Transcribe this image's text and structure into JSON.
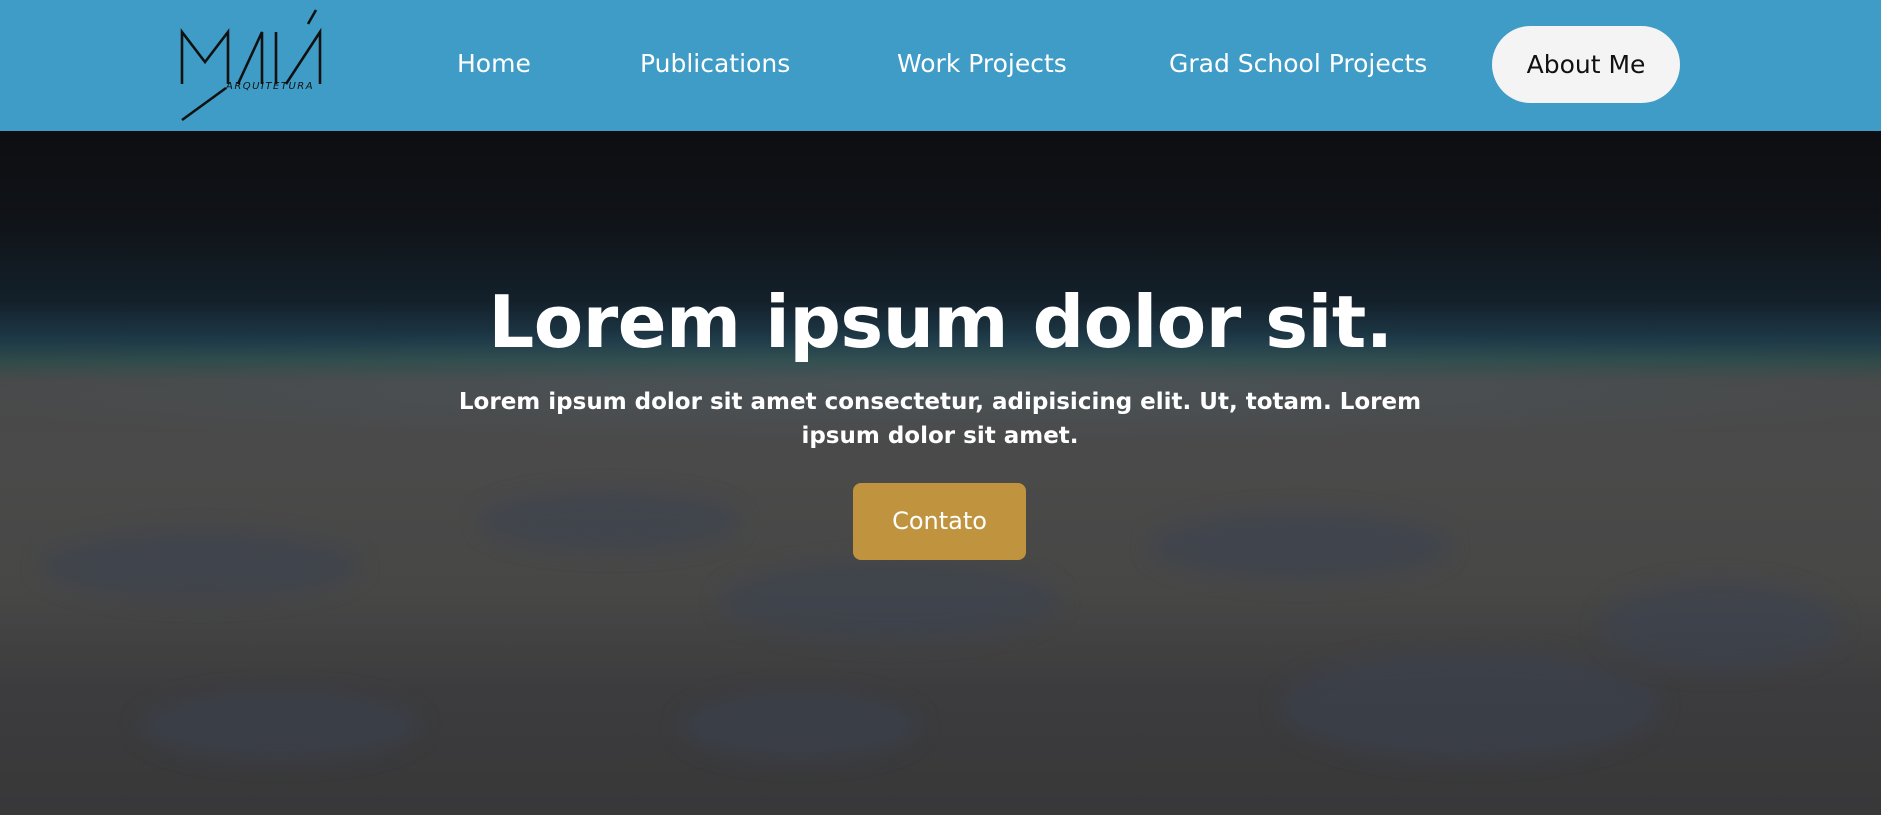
{
  "brand": {
    "logo_text": "MAIÁ",
    "logo_subtitle": "ARQUITETURA"
  },
  "nav": {
    "home": "Home",
    "publications": "Publications",
    "work_projects": "Work Projects",
    "grad_school_projects": "Grad School Projects",
    "about_me": "About Me"
  },
  "hero": {
    "title": "Lorem ipsum dolor sit.",
    "subtitle": "Lorem ipsum dolor sit amet consectetur, adipisicing elit. Ut, totam. Lorem ipsum dolor sit amet.",
    "cta_label": "Contato"
  },
  "colors": {
    "nav_background": "#3f9cc6",
    "cta_background": "#c0943f",
    "about_button_background": "#f4f4f4"
  }
}
